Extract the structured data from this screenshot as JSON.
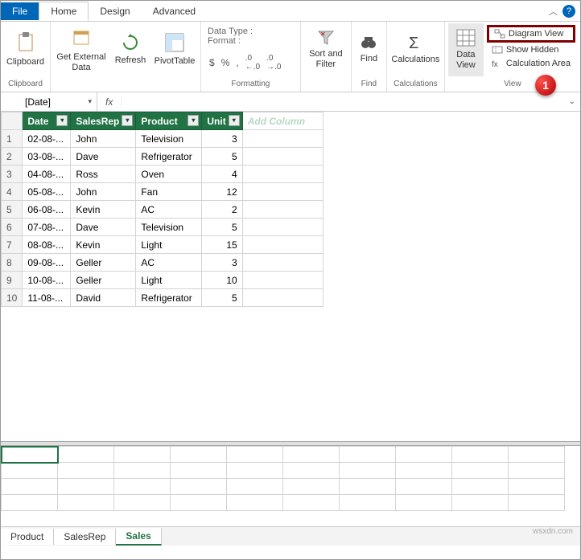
{
  "tabs": {
    "file": "File",
    "home": "Home",
    "design": "Design",
    "advanced": "Advanced"
  },
  "ribbon": {
    "clipboard": {
      "label": "Clipboard",
      "btn": "Clipboard"
    },
    "getdata": {
      "btn": "Get External\nData"
    },
    "refresh": {
      "btn": "Refresh"
    },
    "pivot": {
      "btn": "PivotTable"
    },
    "formatting": {
      "label": "Formatting",
      "datatype_lbl": "Data Type :",
      "format_lbl": "Format :",
      "symbols": [
        "$",
        "%",
        ",",
        ".0←",
        "→.0"
      ]
    },
    "sortfilter": {
      "btn": "Sort and\nFilter"
    },
    "find": {
      "btn": "Find",
      "label": "Find"
    },
    "calc": {
      "btn": "Calculations",
      "label": "Calculations"
    },
    "view": {
      "label": "View",
      "dataview": "Data\nView",
      "diagram": "Diagram View",
      "hidden": "Show Hidden",
      "calcarea": "Calculation Area"
    }
  },
  "callout": "1",
  "fbar": {
    "name": "[Date]",
    "fx": "fx"
  },
  "headers": [
    "Date",
    "SalesRep",
    "Product",
    "Unit"
  ],
  "add_column": "Add Column",
  "rows": [
    {
      "n": "1",
      "date": "02-08-...",
      "rep": "John",
      "prod": "Television",
      "unit": "3"
    },
    {
      "n": "2",
      "date": "03-08-...",
      "rep": "Dave",
      "prod": "Refrigerator",
      "unit": "5"
    },
    {
      "n": "3",
      "date": "04-08-...",
      "rep": "Ross",
      "prod": "Oven",
      "unit": "4"
    },
    {
      "n": "4",
      "date": "05-08-...",
      "rep": "John",
      "prod": "Fan",
      "unit": "12"
    },
    {
      "n": "5",
      "date": "06-08-...",
      "rep": "Kevin",
      "prod": "AC",
      "unit": "2"
    },
    {
      "n": "6",
      "date": "07-08-...",
      "rep": "Dave",
      "prod": "Television",
      "unit": "5"
    },
    {
      "n": "7",
      "date": "08-08-...",
      "rep": "Kevin",
      "prod": "Light",
      "unit": "15"
    },
    {
      "n": "8",
      "date": "09-08-...",
      "rep": "Geller",
      "prod": "AC",
      "unit": "3"
    },
    {
      "n": "9",
      "date": "10-08-...",
      "rep": "Geller",
      "prod": "Light",
      "unit": "10"
    },
    {
      "n": "10",
      "date": "11-08-...",
      "rep": "David",
      "prod": "Refrigerator",
      "unit": "5"
    }
  ],
  "sheets": [
    "Product",
    "SalesRep",
    "Sales"
  ],
  "watermark": "wsxdn.com"
}
